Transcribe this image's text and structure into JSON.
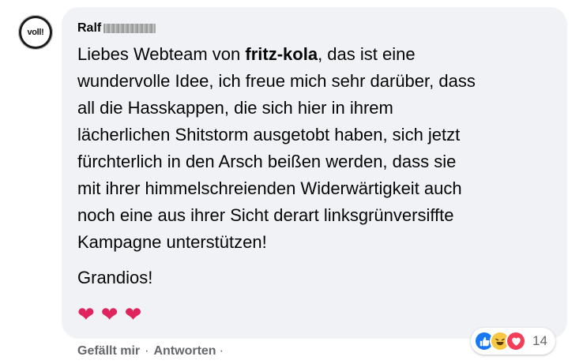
{
  "author": {
    "name": "Ralf"
  },
  "avatar": {
    "text": "voll!"
  },
  "comment": {
    "lines": [
      [
        "Liebes Webteam von ",
        "fritz-kola",
        ", das ist eine"
      ],
      "wundervolle Idee, ich freue mich sehr darüber, dass",
      "all die Hasskappen, die sich hier in ihrem",
      "lächerlichen Shitstorm ausgetobt haben, sich jetzt",
      "fürchterlich in den Arsch beißen werden, dass sie",
      "mit ihrer himmelschreienden Widerwärtigkeit auch",
      "noch eine aus ihrer Sicht derart linksgrünversiffte",
      "Kampagne unterstützen!"
    ],
    "closing": "Grandios!",
    "emoji": [
      "❤",
      "❤",
      "❤"
    ]
  },
  "actions": {
    "like_label": "Gefällt mir",
    "separator": "·",
    "reply_label": "Antworten"
  },
  "reactions": {
    "types": [
      "like-icon",
      "haha-icon",
      "love-icon"
    ],
    "count": "14",
    "colors": {
      "like": "#1877f2",
      "haha": "#f7c843",
      "love": "#f33e58"
    }
  }
}
